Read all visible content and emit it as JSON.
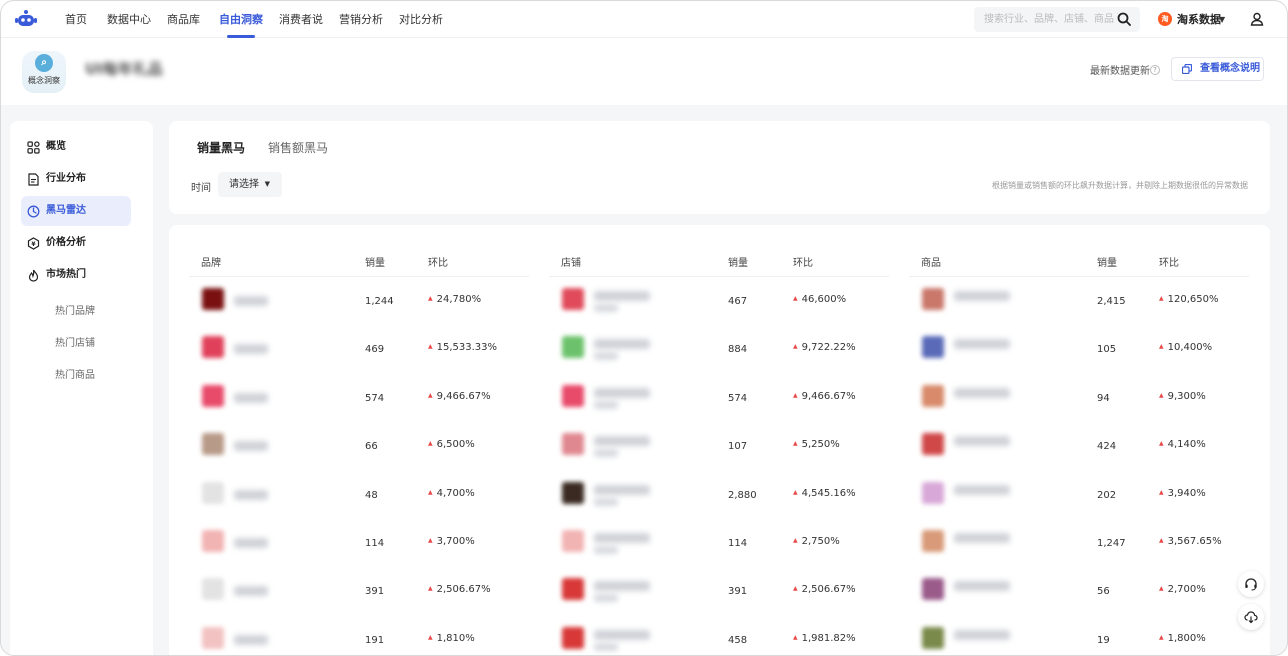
{
  "nav": {
    "items": [
      "首页",
      "数据中心",
      "商品库",
      "自由洞察",
      "消费者说",
      "营销分析",
      "对比分析"
    ],
    "active_index": 3,
    "search_placeholder": "搜索行业、品牌、店铺、商品",
    "brand_logo_text": "淘",
    "brand_name": "淘系数据",
    "accent_color": "#3a5bd9"
  },
  "header": {
    "badge_label": "概念洞察",
    "page_title": "UI每年礼品",
    "update_label": "最新数据更新",
    "explain_button": "查看概念说明"
  },
  "sidebar": {
    "items": [
      {
        "label": "概览",
        "icon": "grid-icon"
      },
      {
        "label": "行业分布",
        "icon": "document-icon"
      },
      {
        "label": "黑马雷达",
        "icon": "radar-icon",
        "active": true
      },
      {
        "label": "价格分析",
        "icon": "price-tag-icon"
      },
      {
        "label": "市场热门",
        "icon": "flame-icon"
      }
    ],
    "subitems": [
      "热门品牌",
      "热门店铺",
      "热门商品"
    ]
  },
  "filter": {
    "tabs": [
      "销量黑马",
      "销售额黑马"
    ],
    "active_tab": 0,
    "time_label": "时间",
    "time_select": "请选择",
    "note": "根据销量或销售额的环比飙升数据计算，并剔除上期数据很低的异常数据"
  },
  "tables": [
    {
      "headers": [
        "品牌",
        "销量",
        "环比"
      ],
      "rows": [
        {
          "sales": "1,244",
          "ratio": "24,780%",
          "thumb": "#7a1010"
        },
        {
          "sales": "469",
          "ratio": "15,533.33%",
          "thumb": "#e0405a"
        },
        {
          "sales": "574",
          "ratio": "9,466.67%",
          "thumb": "#e84a6a"
        },
        {
          "sales": "66",
          "ratio": "6,500%",
          "thumb": "#b89a88"
        },
        {
          "sales": "48",
          "ratio": "4,700%",
          "thumb": "#e3e3e3"
        },
        {
          "sales": "114",
          "ratio": "3,700%",
          "thumb": "#f2b3b3"
        },
        {
          "sales": "391",
          "ratio": "2,506.67%",
          "thumb": "#e3e3e3"
        },
        {
          "sales": "191",
          "ratio": "1,810%",
          "thumb": "#f2c2c2"
        }
      ]
    },
    {
      "headers": [
        "店铺",
        "销量",
        "环比"
      ],
      "rows": [
        {
          "sales": "467",
          "ratio": "46,600%",
          "thumb": "#e04a5a"
        },
        {
          "sales": "884",
          "ratio": "9,722.22%",
          "thumb": "#6cc26c"
        },
        {
          "sales": "574",
          "ratio": "9,466.67%",
          "thumb": "#e84a6a"
        },
        {
          "sales": "107",
          "ratio": "5,250%",
          "thumb": "#e08890"
        },
        {
          "sales": "2,880",
          "ratio": "4,545.16%",
          "thumb": "#3a2a22"
        },
        {
          "sales": "114",
          "ratio": "2,750%",
          "thumb": "#f2b3b3"
        },
        {
          "sales": "391",
          "ratio": "2,506.67%",
          "thumb": "#d83838"
        },
        {
          "sales": "458",
          "ratio": "1,981.82%",
          "thumb": "#d83838"
        }
      ]
    },
    {
      "headers": [
        "商品",
        "销量",
        "环比"
      ],
      "rows": [
        {
          "sales": "2,415",
          "ratio": "120,650%",
          "thumb": "#c9786a"
        },
        {
          "sales": "105",
          "ratio": "10,400%",
          "thumb": "#5a6ab8"
        },
        {
          "sales": "94",
          "ratio": "9,300%",
          "thumb": "#d88a6a"
        },
        {
          "sales": "424",
          "ratio": "4,140%",
          "thumb": "#d04848"
        },
        {
          "sales": "202",
          "ratio": "3,940%",
          "thumb": "#d8a8d8"
        },
        {
          "sales": "1,247",
          "ratio": "3,567.65%",
          "thumb": "#d89a78"
        },
        {
          "sales": "56",
          "ratio": "2,700%",
          "thumb": "#9a5a8a"
        },
        {
          "sales": "19",
          "ratio": "1,800%",
          "thumb": "#7a8a4a"
        }
      ]
    }
  ]
}
